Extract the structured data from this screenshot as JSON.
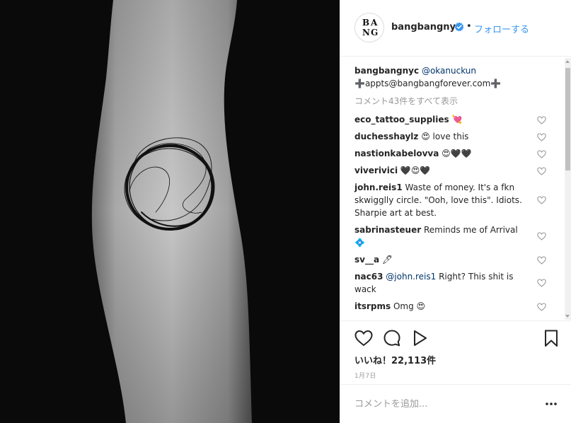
{
  "header": {
    "username": "bangbangnyc",
    "separator": "•",
    "follow_label": "フォローする",
    "avatar_letters": [
      "B",
      "A",
      "N",
      "G"
    ],
    "verified_icon": "verified-badge-icon",
    "colors": {
      "link": "#3897f0",
      "verified": "#3897f0"
    }
  },
  "caption": {
    "username": "bangbangnyc",
    "mention": "@okanuckun",
    "text": "➕appts@bangbangforever.com➕",
    "view_all": "コメント43件をすべて表示"
  },
  "comments": [
    {
      "user": "eco_tattoo_supplies",
      "text": "💘"
    },
    {
      "user": "duchesshaylz",
      "text": "😍 love this"
    },
    {
      "user": "nastionkabelovva",
      "text": "😍🖤🖤"
    },
    {
      "user": "viverivici",
      "text": "🖤😍🖤"
    },
    {
      "user": "john.reis1",
      "lines": [
        "Waste of money. It's a fkn",
        "skwigglly circle. \"Ooh, love this\". Idiots.",
        "Sharpie art at best."
      ]
    },
    {
      "user": "sabrinasteuer",
      "lines": [
        "Reminds me of Arrival",
        "💠"
      ]
    },
    {
      "user": "sv__a",
      "text": "🖊"
    },
    {
      "user": "nac63",
      "mention": "@john.reis1",
      "lines": [
        " Right? This shit is",
        "wack"
      ]
    },
    {
      "user": "itsrpms",
      "text": "Omg 😍"
    }
  ],
  "actions": {
    "likes_text": "いいね！22,113件",
    "date": "1月7日"
  },
  "comment_box": {
    "placeholder": "コメントを追加...",
    "more_icon": "more-options-icon"
  }
}
